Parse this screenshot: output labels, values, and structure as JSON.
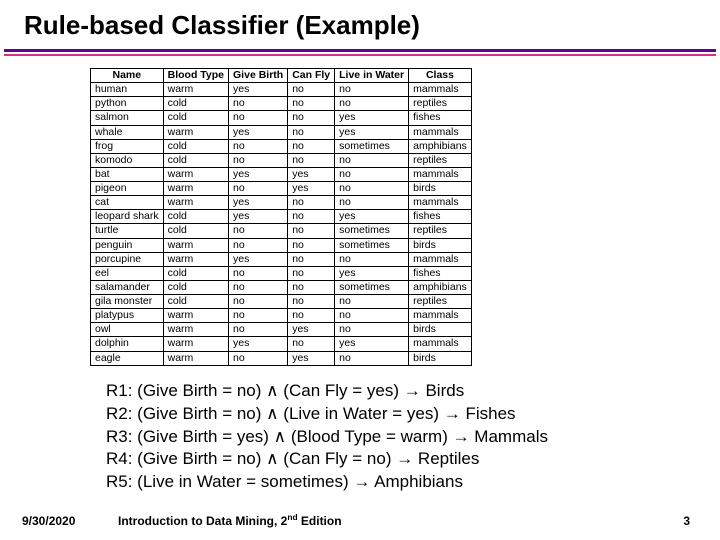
{
  "title": "Rule-based Classifier (Example)",
  "table": {
    "headers": [
      "Name",
      "Blood Type",
      "Give Birth",
      "Can Fly",
      "Live in Water",
      "Class"
    ],
    "rows": [
      [
        "human",
        "warm",
        "yes",
        "no",
        "no",
        "mammals"
      ],
      [
        "python",
        "cold",
        "no",
        "no",
        "no",
        "reptiles"
      ],
      [
        "salmon",
        "cold",
        "no",
        "no",
        "yes",
        "fishes"
      ],
      [
        "whale",
        "warm",
        "yes",
        "no",
        "yes",
        "mammals"
      ],
      [
        "frog",
        "cold",
        "no",
        "no",
        "sometimes",
        "amphibians"
      ],
      [
        "komodo",
        "cold",
        "no",
        "no",
        "no",
        "reptiles"
      ],
      [
        "bat",
        "warm",
        "yes",
        "yes",
        "no",
        "mammals"
      ],
      [
        "pigeon",
        "warm",
        "no",
        "yes",
        "no",
        "birds"
      ],
      [
        "cat",
        "warm",
        "yes",
        "no",
        "no",
        "mammals"
      ],
      [
        "leopard shark",
        "cold",
        "yes",
        "no",
        "yes",
        "fishes"
      ],
      [
        "turtle",
        "cold",
        "no",
        "no",
        "sometimes",
        "reptiles"
      ],
      [
        "penguin",
        "warm",
        "no",
        "no",
        "sometimes",
        "birds"
      ],
      [
        "porcupine",
        "warm",
        "yes",
        "no",
        "no",
        "mammals"
      ],
      [
        "eel",
        "cold",
        "no",
        "no",
        "yes",
        "fishes"
      ],
      [
        "salamander",
        "cold",
        "no",
        "no",
        "sometimes",
        "amphibians"
      ],
      [
        "gila monster",
        "cold",
        "no",
        "no",
        "no",
        "reptiles"
      ],
      [
        "platypus",
        "warm",
        "no",
        "no",
        "no",
        "mammals"
      ],
      [
        "owl",
        "warm",
        "no",
        "yes",
        "no",
        "birds"
      ],
      [
        "dolphin",
        "warm",
        "yes",
        "no",
        "yes",
        "mammals"
      ],
      [
        "eagle",
        "warm",
        "no",
        "yes",
        "no",
        "birds"
      ]
    ]
  },
  "rules": [
    "R1: (Give Birth = no) ∧ (Can Fly = yes) → Birds",
    "R2: (Give Birth = no) ∧ (Live in Water = yes) → Fishes",
    "R3: (Give Birth = yes) ∧ (Blood Type = warm) → Mammals",
    "R4: (Give Birth = no) ∧ (Can Fly = no) → Reptiles",
    "R5: (Live in Water = sometimes) → Amphibians"
  ],
  "footer": {
    "date": "9/30/2020",
    "src_prefix": "Introduction to Data Mining, 2",
    "src_suffix": " Edition",
    "page": "3"
  }
}
